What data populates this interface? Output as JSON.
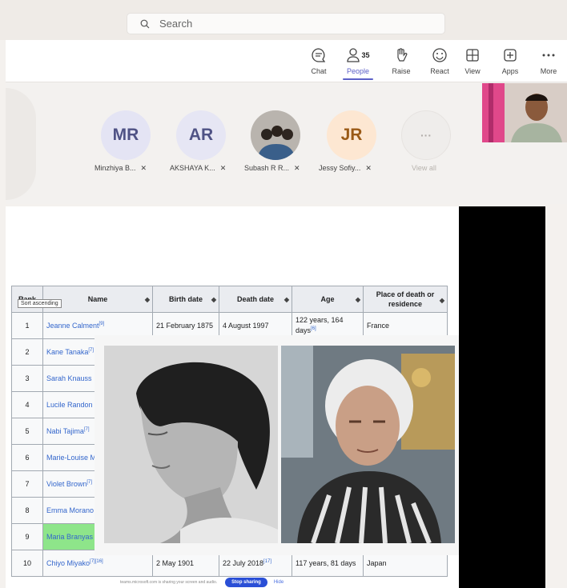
{
  "search": {
    "placeholder": "Search"
  },
  "toolbar": [
    {
      "label": "Chat",
      "icon": "chat-icon"
    },
    {
      "label": "People",
      "icon": "people-icon",
      "badge": "35",
      "active": true
    },
    {
      "label": "Raise",
      "icon": "raise-hand-icon"
    },
    {
      "label": "React",
      "icon": "react-icon"
    },
    {
      "label": "View",
      "icon": "view-icon"
    },
    {
      "label": "Apps",
      "icon": "apps-icon"
    },
    {
      "label": "More",
      "icon": "more-icon"
    }
  ],
  "participants": [
    {
      "initials": "MR",
      "name": "Minzhiya B..."
    },
    {
      "initials": "AR",
      "name": "AKSHAYA K..."
    },
    {
      "initials": "",
      "name": "Subash R R..."
    },
    {
      "initials": "JR",
      "name": "Jessy Sofiy..."
    }
  ],
  "view_all": {
    "label": "View all",
    "glyph": "···"
  },
  "table": {
    "headers": [
      "Rank",
      "Name",
      "Birth date",
      "Death date",
      "Age",
      "Place of death or residence"
    ],
    "tooltip": "Sort ascending",
    "rows": [
      {
        "rank": "1",
        "name": "Jeanne Calment",
        "ref": "[9]",
        "birth": "21 February 1875",
        "death": "4 August 1997",
        "age": "122 years, 164 days",
        "age_ref": "[6]",
        "place": "France"
      },
      {
        "rank": "2",
        "name": "Kane Tanaka",
        "ref": "[7]"
      },
      {
        "rank": "3",
        "name": "Sarah Knauss",
        "ref": ""
      },
      {
        "rank": "4",
        "name": "Lucile Randon",
        "ref": ""
      },
      {
        "rank": "5",
        "name": "Nabi Tajima",
        "ref": "[7]"
      },
      {
        "rank": "6",
        "name": "Marie-Louise M",
        "ref": ""
      },
      {
        "rank": "7",
        "name": "Violet Brown",
        "ref": "[7]"
      },
      {
        "rank": "8",
        "name": "Emma Morano",
        "ref": ""
      },
      {
        "rank": "9",
        "name": "Maria Branyas",
        "ref": "",
        "highlight": true
      },
      {
        "rank": "10",
        "name": "Chiyo Miyako",
        "ref": "[7][16]",
        "birth": "2 May 1901",
        "death": "22 July 2018",
        "death_ref": "[17]",
        "age": "117 years, 81 days",
        "place": "Japan"
      }
    ]
  },
  "share_bar": {
    "message": "teams.microsoft.com is sharing your screen and audio.",
    "stop": "Stop sharing",
    "hide": "Hide"
  },
  "colors": {
    "accent": "#5b5fc7",
    "link": "#3366cc",
    "highlight": "#8ee58a",
    "stop_button": "#2a4fd6"
  }
}
